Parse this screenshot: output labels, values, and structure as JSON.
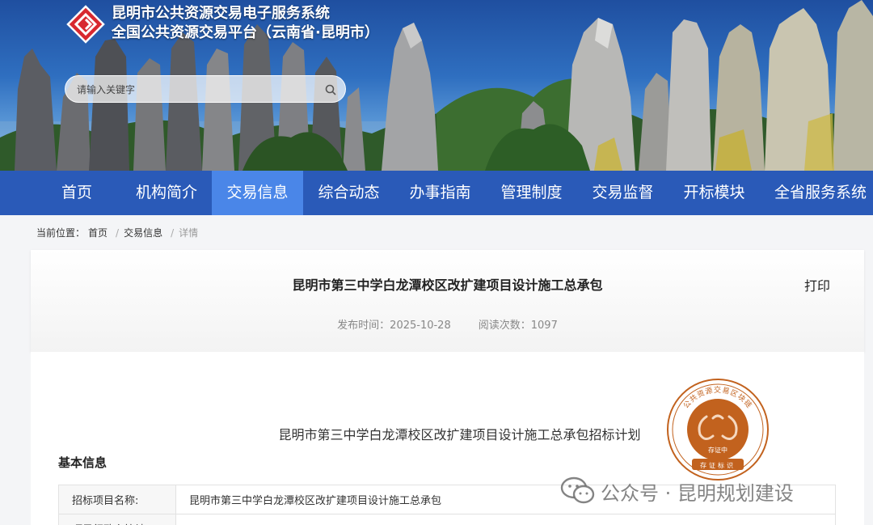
{
  "site": {
    "title_line1": "昆明市公共资源交易电子服务系统",
    "title_line2": "全国公共资源交易平台（云南省·昆明市）"
  },
  "search": {
    "placeholder": "请输入关键字"
  },
  "nav": {
    "items": [
      {
        "label": "首页"
      },
      {
        "label": "机构简介"
      },
      {
        "label": "交易信息"
      },
      {
        "label": "综合动态"
      },
      {
        "label": "办事指南"
      },
      {
        "label": "管理制度"
      },
      {
        "label": "交易监督"
      },
      {
        "label": "开标模块"
      },
      {
        "label": "全省服务系统"
      }
    ],
    "active_index": 2
  },
  "breadcrumb": {
    "prefix": "当前位置：",
    "items": [
      "首页",
      "交易信息",
      "详情"
    ]
  },
  "article": {
    "title": "昆明市第三中学白龙潭校区改扩建项目设计施工总承包",
    "print_label": "打印",
    "publish_label": "发布时间：",
    "publish_date": "2025-10-28",
    "views_label": "阅读次数：",
    "views": "1097",
    "doc_title": "昆明市第三中学白龙潭校区改扩建项目设计施工总承包招标计划",
    "section_title": "基本信息",
    "table": [
      {
        "key": "招标项目名称:",
        "value": "昆明市第三中学白龙潭校区改扩建项目设计施工总承包"
      },
      {
        "key": "项目行政主管地...",
        "value": ""
      }
    ]
  },
  "seal": {
    "top_text": "公共资源交易区块链",
    "middle_text": "存证中",
    "bottom_text": "存证标识"
  },
  "watermark": {
    "text": "公众号 · 昆明规划建设"
  },
  "colors": {
    "nav_bg": "#2a5ab8",
    "nav_active": "#4a86e8",
    "logo_red": "#d8282f",
    "seal_orange": "#c2621e"
  }
}
